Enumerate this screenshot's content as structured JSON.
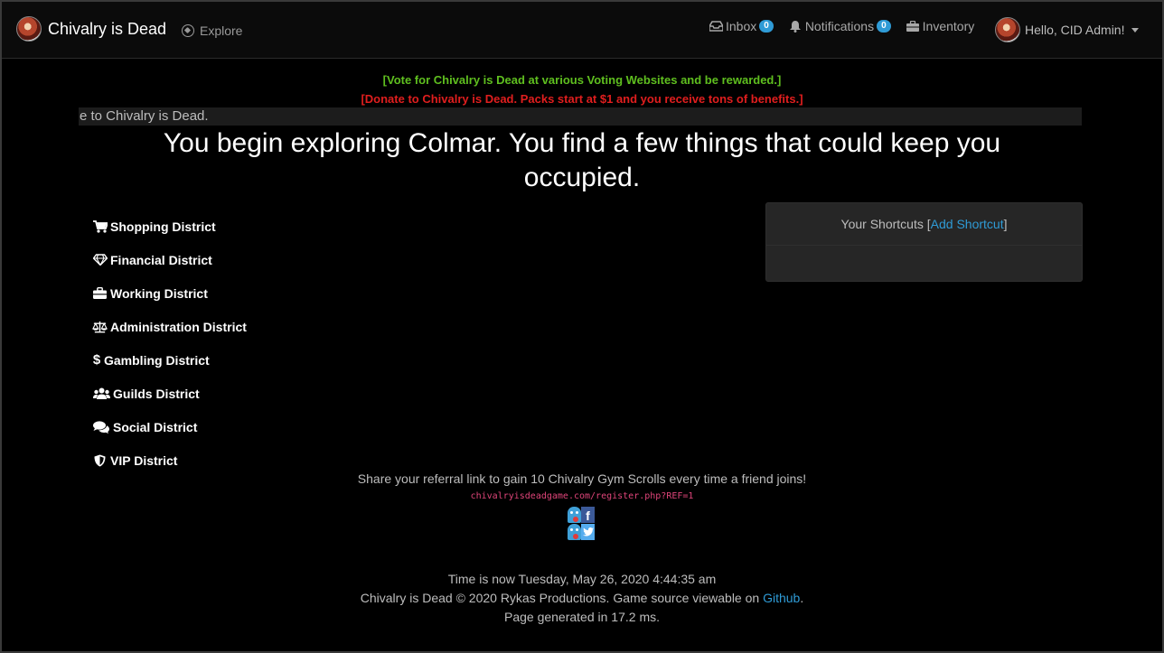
{
  "navbar": {
    "brand": "Chivalry is Dead",
    "explore": "Explore",
    "inbox": {
      "label": "Inbox",
      "count": "0"
    },
    "notifications": {
      "label": "Notifications",
      "count": "0"
    },
    "inventory": "Inventory",
    "user_greeting": "Hello, CID Admin!"
  },
  "banners": {
    "vote": "[Vote for Chivalry is Dead at various Voting Websites and be rewarded.]",
    "donate": "[Donate to Chivalry is Dead. Packs start at $1 and you receive tons of benefits.]",
    "marquee": "e to Chivalry is Dead."
  },
  "headline": {
    "line1": "You begin exploring Colmar. You find a few things that could keep you",
    "line2": "occupied."
  },
  "districts": [
    {
      "label": "Shopping District",
      "icon": "cart-icon"
    },
    {
      "label": "Financial District",
      "icon": "diamond-icon"
    },
    {
      "label": "Working District",
      "icon": "briefcase-icon"
    },
    {
      "label": "Administration District",
      "icon": "balance-scale-icon"
    },
    {
      "label": "Gambling District",
      "icon": "dollar-icon"
    },
    {
      "label": "Guilds District",
      "icon": "users-icon"
    },
    {
      "label": "Social District",
      "icon": "comments-icon"
    },
    {
      "label": "VIP District",
      "icon": "shield-icon"
    }
  ],
  "shortcuts": {
    "title": "Your Shortcuts",
    "bracket_open": "[",
    "add_label": "Add Shortcut",
    "bracket_close": "]"
  },
  "referral": {
    "text": "Share your referral link to gain 10 Chivalry Gym Scrolls every time a friend joins!",
    "link": "chivalryisdeadgame.com/register.php?REF=1",
    "facebook_glyph": "f"
  },
  "footer": {
    "time": "Time is now Tuesday, May 26, 2020 4:44:35 am",
    "copyright_prefix": "Chivalry is Dead © 2020 Rykas Productions. Game source viewable on ",
    "github": "Github",
    "copyright_suffix": ".",
    "generated": "Page generated in 17.2 ms."
  },
  "colors": {
    "accent": "#2f9bd6",
    "vote": "#5fbf1f",
    "donate": "#e01e1e",
    "ref_link": "#e0457a"
  }
}
